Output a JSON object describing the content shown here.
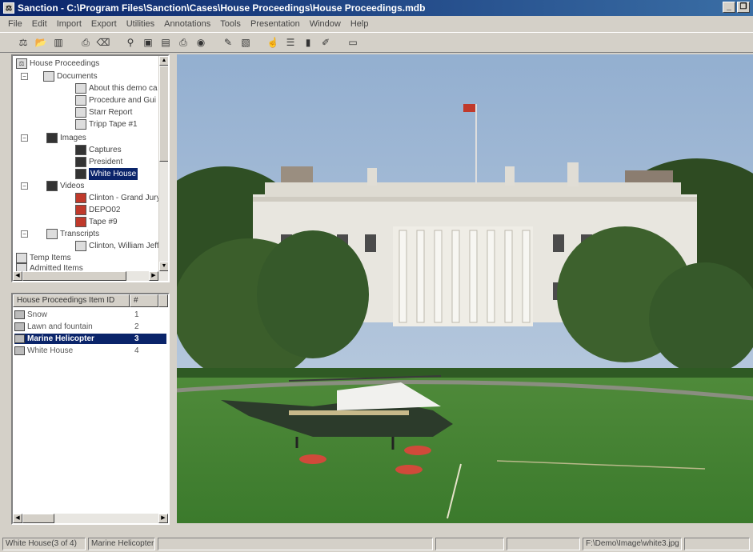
{
  "window": {
    "title": "Sanction - C:\\Program Files\\Sanction\\Cases\\House Proceedings\\House Proceedings.mdb"
  },
  "menu": [
    "File",
    "Edit",
    "Import",
    "Export",
    "Utilities",
    "Annotations",
    "Tools",
    "Presentation",
    "Window",
    "Help"
  ],
  "tree": {
    "root": "House Proceedings",
    "documents_label": "Documents",
    "documents": [
      "About this demo ca",
      "Procedure and Gui",
      "Starr Report",
      "Tripp Tape #1"
    ],
    "images_label": "Images",
    "images": [
      "Captures",
      "President",
      "White House"
    ],
    "videos_label": "Videos",
    "videos": [
      "Clinton - Grand Jury",
      "DEPO02",
      "Tape #9"
    ],
    "transcripts_label": "Transcripts",
    "transcripts": [
      "Clinton, William Jeff"
    ],
    "temp_items": "Temp Items",
    "admitted_items": "Admitted Items"
  },
  "list": {
    "col1": "House Proceedings Item ID",
    "col2": "#",
    "rows": [
      {
        "name": "Snow",
        "num": "1"
      },
      {
        "name": "Lawn and fountain",
        "num": "2"
      },
      {
        "name": "Marine Helicopter",
        "num": "3"
      },
      {
        "name": "White House",
        "num": "4"
      }
    ]
  },
  "status": {
    "position": "White House(3 of 4)",
    "item": "Marine Helicopter",
    "path": "F:\\Demo\\Image\\white3.jpg"
  },
  "colors": {
    "titlebar": "#0a246a",
    "selection": "#0a246a",
    "chrome": "#d4d0c8"
  }
}
